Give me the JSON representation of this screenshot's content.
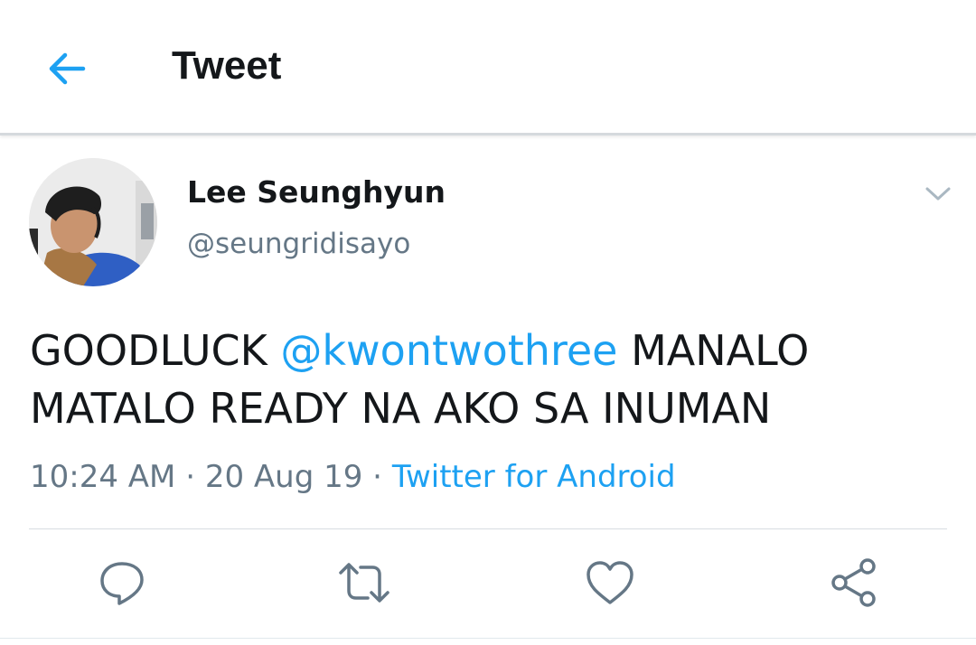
{
  "header": {
    "title": "Tweet",
    "back_icon": "arrow-left-icon"
  },
  "author": {
    "display_name": "Lee Seunghyun",
    "handle": "@seungridisayo"
  },
  "tweet": {
    "line1_before": "GOODLUCK ",
    "mention": "@kwontwothree",
    "line1_after": " MANALO",
    "line2": "MATALO READY NA AKO SA INUMAN"
  },
  "meta": {
    "time": "10:24 AM",
    "sep1": " · ",
    "date": "20 Aug 19",
    "sep2": " · ",
    "source": "Twitter for Android"
  },
  "actions": {
    "reply_icon": "reply-icon",
    "retweet_icon": "retweet-icon",
    "like_icon": "heart-icon",
    "share_icon": "share-icon"
  },
  "colors": {
    "accent": "#1da1f2",
    "text": "#14171a",
    "secondary": "#657786",
    "icon": "#657786"
  }
}
